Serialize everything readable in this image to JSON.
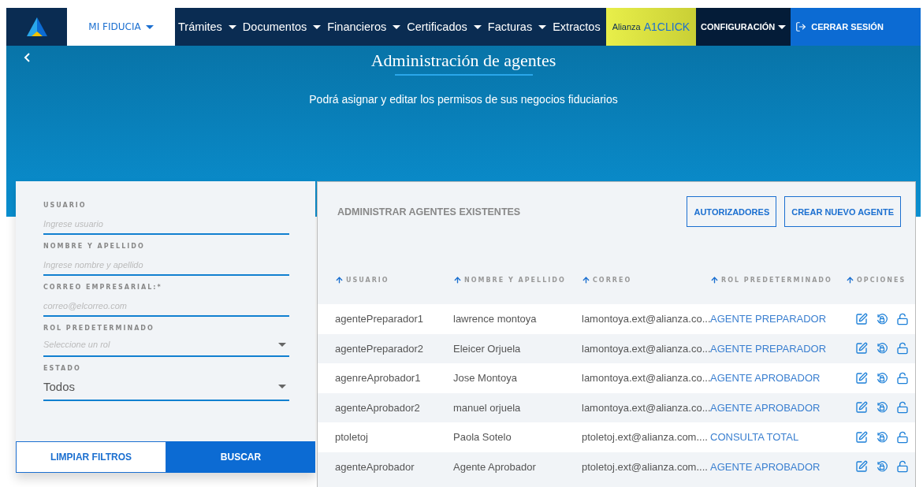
{
  "nav": {
    "menu": {
      "label": "MI FIDUCIA",
      "selected": true
    },
    "items": [
      {
        "label": "Trámites",
        "dropdown": true
      },
      {
        "label": "Documentos",
        "dropdown": true
      },
      {
        "label": "Financieros",
        "dropdown": true
      },
      {
        "label": "Certificados",
        "dropdown": true
      },
      {
        "label": "Facturas",
        "dropdown": true
      },
      {
        "label": "Extractos",
        "dropdown": false
      }
    ],
    "promo": {
      "prefix": "Alianza",
      "brand": "A1CLICK"
    },
    "settings": "CONFIGURACIÓN",
    "logout": "CERRAR SESIÓN"
  },
  "hero": {
    "title": "Administración de agentes",
    "subtitle": "Podrá asignar y editar los permisos de sus negocios fiduciarios"
  },
  "filters": {
    "fields": [
      {
        "kind": "text",
        "label": "USUARIO",
        "placeholder": "Ingrese usuario"
      },
      {
        "kind": "text",
        "label": "NOMBRE Y APELLIDO",
        "placeholder": "Ingrese nombre y apellido"
      },
      {
        "kind": "text",
        "label": "CORREO EMPRESARIAL:*",
        "placeholder": "correo@elcorreo.com"
      },
      {
        "kind": "select",
        "label": "ROL PREDETERMINADO",
        "placeholder": "Seleccione un rol"
      },
      {
        "kind": "select",
        "label": "ESTADO",
        "value": "Todos"
      }
    ],
    "clear": "LIMPIAR FILTROS",
    "search": "BUSCAR"
  },
  "table": {
    "title": "ADMINISTRAR AGENTES EXISTENTES",
    "buttons": [
      "AUTORIZADORES",
      "CREAR NUEVO AGENTE"
    ],
    "columns": [
      "USUARIO",
      "NOMBRE Y APELLIDO",
      "CORREO",
      "ROL PREDETERMINADO",
      "OPCIONES"
    ],
    "rows": [
      [
        "agentePreparador1",
        "lawrence montoya",
        "lamontoya.ext@alianza.co...",
        "AGENTE PREPARADOR"
      ],
      [
        "agentePreparador2",
        "Eleicer Orjuela",
        "lamontoya.ext@alianza.co...",
        "AGENTE PREPARADOR"
      ],
      [
        "agenreAprobador1",
        "Jose Montoya",
        "lamontoya.ext@alianza.co...",
        "AGENTE APROBADOR"
      ],
      [
        "agenteAprobador2",
        "manuel orjuela",
        "lamontoya.ext@alianza.co...",
        "AGENTE APROBADOR"
      ],
      [
        "ptoletoj",
        "Paola Sotelo",
        "ptoletoj.ext@alianza.com....",
        "CONSULTA TOTAL"
      ],
      [
        "agenteAprobador",
        "Agente Aprobador",
        "ptoletoj.ext@alianza.com....",
        "AGENTE APROBADOR"
      ]
    ]
  }
}
